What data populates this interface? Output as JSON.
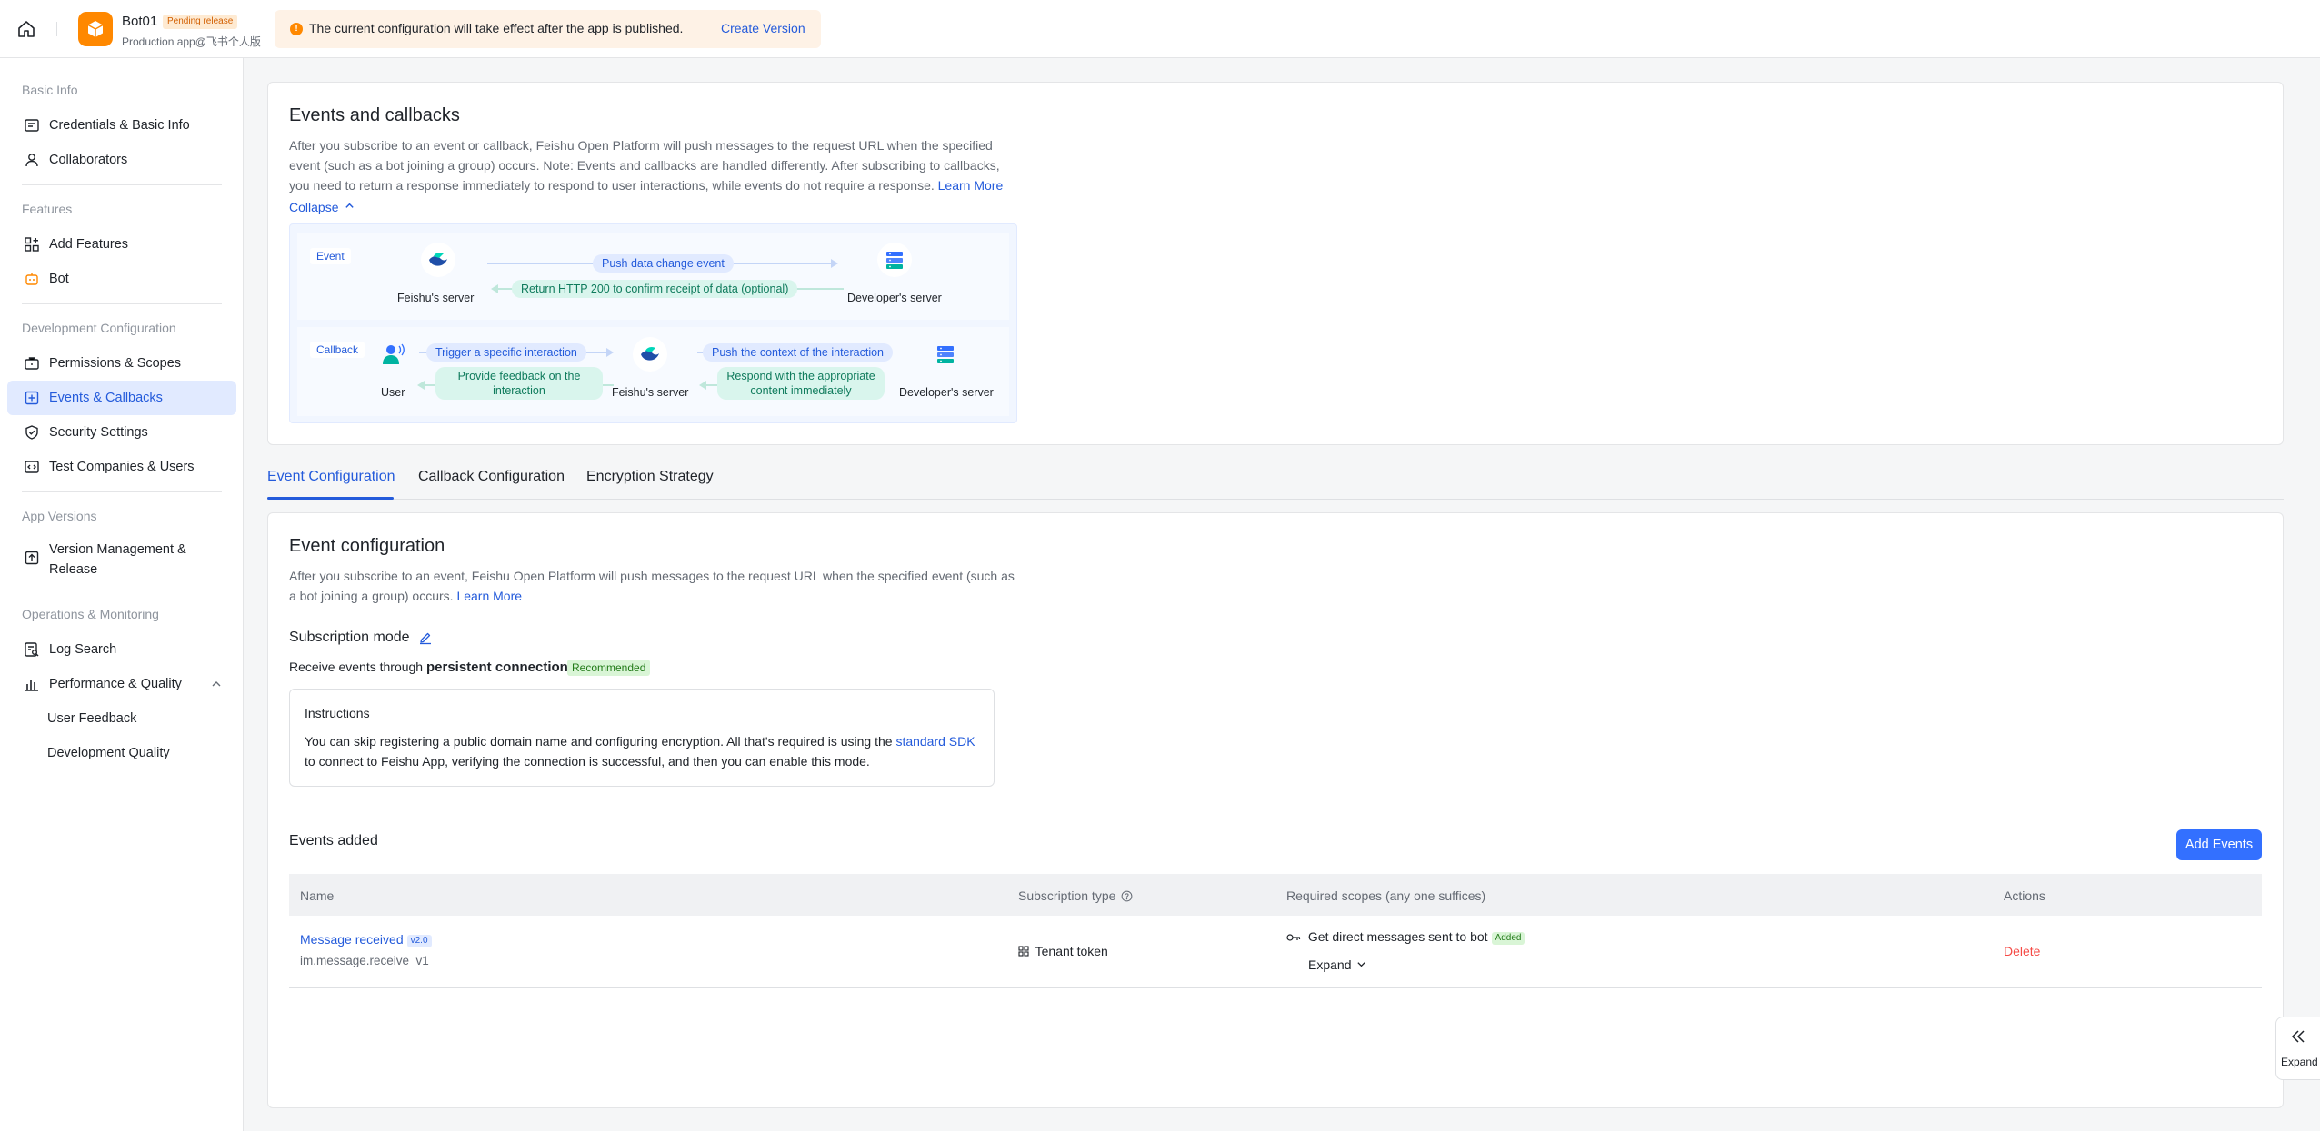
{
  "header": {
    "app_name": "Bot01",
    "status_tag": "Pending release",
    "app_subtitle": "Production app@飞书个人版",
    "notice_text": "The current configuration will take effect after the app is published.",
    "notice_link": "Create Version"
  },
  "sidebar": {
    "groups": {
      "basic": "Basic Info",
      "features": "Features",
      "dev": "Development Configuration",
      "versions": "App Versions",
      "ops": "Operations & Monitoring"
    },
    "items": {
      "credentials": "Credentials & Basic Info",
      "collaborators": "Collaborators",
      "add_features": "Add Features",
      "bot": "Bot",
      "permissions": "Permissions & Scopes",
      "events": "Events & Callbacks",
      "security": "Security Settings",
      "test": "Test Companies & Users",
      "version_mgmt_1": "Version Management &",
      "version_mgmt_2": "Release",
      "log_search": "Log Search",
      "performance": "Performance & Quality",
      "user_feedback": "User Feedback",
      "dev_quality": "Development Quality"
    }
  },
  "events_callbacks": {
    "title": "Events and callbacks",
    "desc_1": "After you subscribe to an event or callback, Feishu Open Platform will push messages to the request URL when the specified",
    "desc_2": "event (such as a bot joining a group) occurs. Note: Events and callbacks are handled differently. After subscribing to callbacks,",
    "desc_3": "you need to return a response immediately to respond to user interactions, while events do not require a response.",
    "learn_more": "Learn More",
    "collapse": "Collapse",
    "diagram": {
      "event_tag": "Event",
      "callback_tag": "Callback",
      "feishu_server": "Feishu's server",
      "developer_server": "Developer's server",
      "user": "User",
      "push_event": "Push data change event",
      "return_200": "Return HTTP 200 to confirm receipt of data (optional)",
      "trigger": "Trigger a specific interaction",
      "feedback": "Provide feedback on the interaction",
      "push_context": "Push the context of the interaction",
      "respond": "Respond with the appropriate content immediately"
    }
  },
  "tabs": [
    "Event Configuration",
    "Callback Configuration",
    "Encryption Strategy"
  ],
  "event_config": {
    "title": "Event configuration",
    "desc_1": "After you subscribe to an event, Feishu Open Platform will push messages to the request URL when the specified event (such as",
    "desc_2": "a bot joining a group) occurs.",
    "learn_more": "Learn More",
    "subscription_mode_label": "Subscription mode",
    "receive_prefix": "Receive events through",
    "receive_mode": "persistent connection",
    "recommended": "Recommended",
    "instructions_title": "Instructions",
    "instructions_1": "You can skip registering a public domain name and configuring encryption. All that's required is using the",
    "instructions_link": "standard SDK",
    "instructions_2": "to connect to Feishu App, verifying the connection is successful, and then you can enable this mode.",
    "events_added_title": "Events added",
    "add_events_button": "Add Events"
  },
  "table": {
    "headers": {
      "name": "Name",
      "subscription_type": "Subscription type",
      "required_scopes": "Required scopes (any one suffices)",
      "actions": "Actions"
    },
    "rows": [
      {
        "name": "Message received",
        "version": "v2.0",
        "key": "im.message.receive_v1",
        "subscription_type": "Tenant token",
        "scope": "Get direct messages sent to bot",
        "scope_status": "Added",
        "expand": "Expand",
        "action": "Delete"
      }
    ]
  },
  "side_expand": "Expand",
  "colors": {
    "primary": "#245bdb",
    "primary_button": "#3370ff",
    "warning": "#ff8800",
    "danger": "#f54a45",
    "success_tag_bg": "#d9f5d6"
  }
}
